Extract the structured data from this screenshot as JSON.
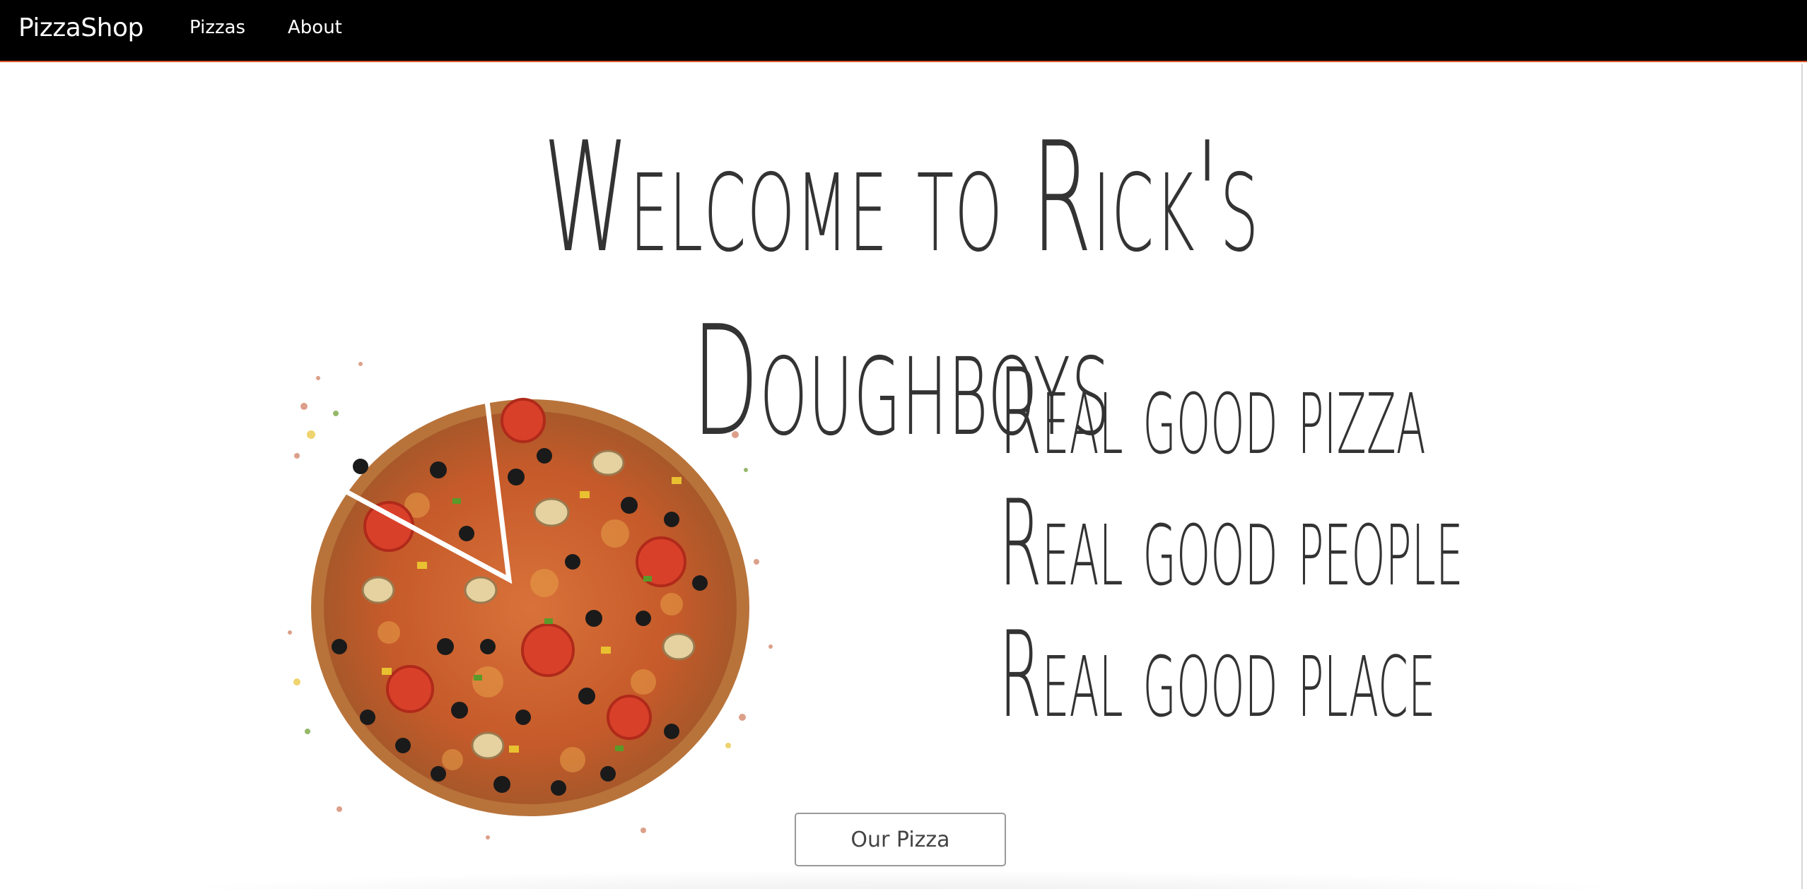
{
  "navbar": {
    "brand": "PizzaShop",
    "links": [
      {
        "label": "Pizzas"
      },
      {
        "label": "About"
      }
    ]
  },
  "hero": {
    "title": "Welcome to Rick's Doughboys",
    "taglines": [
      "Real good pizza",
      "Real good people",
      "Real good place"
    ],
    "button_label": "Our Pizza"
  },
  "colors": {
    "navbar_bg": "#000000",
    "navbar_border": "#e05a2b",
    "text": "#333333",
    "pizza_crust": "#b8733a",
    "pizza_sauce": "#c9542a",
    "olive": "#1a1a1a",
    "tomato": "#d9402a"
  },
  "icons": {
    "pizza_image": "pizza-illustration"
  }
}
